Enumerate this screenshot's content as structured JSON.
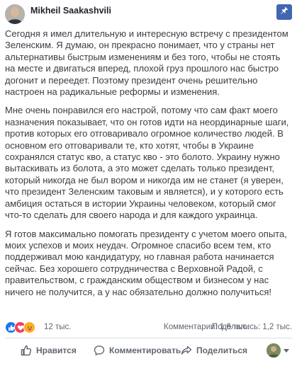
{
  "post": {
    "author": "Mikheil Saakashvili",
    "paragraphs": [
      "Сегодня я имел длительную и интересную встречу с президентом Зеленским. Я думаю, он прекрасно понимает, что у страны нет альтернативы быстрым изменениям и без того, чтобы не стоять на месте и двигаться вперед, плохой груз прошлого нас быстро догонит и переедет. Поэтому президент очень решительно настроен на радикальные реформы и изменения.",
      "Мне очень понравился его настрой, потому что сам факт моего назначения показывает, что он готов идти на неординарные шаги, против которых его отговаривало огромное количество людей. В основном его отговаривали те, кто хотят, чтобы в Украине сохранялся статус кво, а статус кво - это болото. Украину нужно вытаскивать из болота, а это может сделать только президент, который никогда не был вором и никогда им не станет (я уверен, что президент Зеленским таковым и является), и у которого есть амбиция остаться в истории Украины человеком, который смог что-то сделать для своего народа и для каждого украинца.",
      "Я готов максимально помогать президенту с учетом моего опыта, моих успехов и моих неудач. Огромное спасибо всем тем, кто поддерживал мою кандидатуру, но главная работа начинается сейчас. Без хорошего сотрудничества с Верховной Радой, с правительством, с гражданским обществом и бизнесом у нас ничего не получится, а у нас обязательно должно получиться!"
    ]
  },
  "stats": {
    "reactions": "12 тыс.",
    "comments": "Комментарии: 1,6 тыс.",
    "shares": "Поделились: 1,2 тыс."
  },
  "actions": {
    "like": "Нравится",
    "comment": "Комментировать",
    "share": "Поделиться"
  },
  "colors": {
    "brand": "#4267b2",
    "like": "#1877f2",
    "love": "#f33e58",
    "care": "#f7b125",
    "muted": "#606770"
  },
  "icons": {
    "pin": "pushpin-icon",
    "like": "thumbs-up-icon",
    "comment": "speech-bubble-icon",
    "share": "share-arrow-icon"
  }
}
